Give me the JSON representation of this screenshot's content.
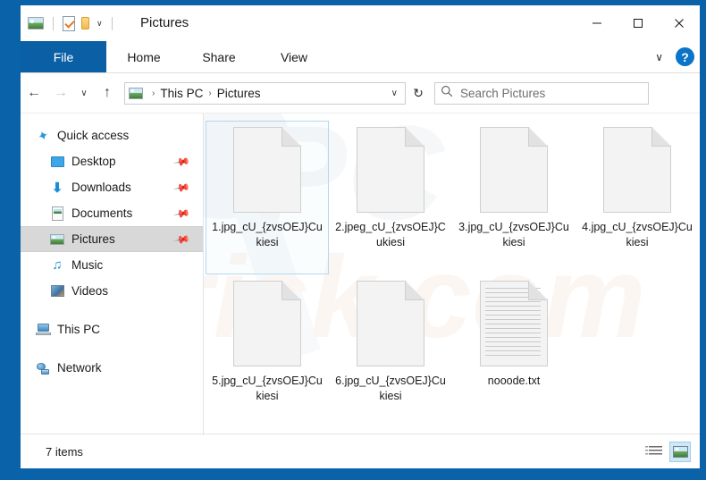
{
  "window": {
    "title": "Pictures",
    "quick_access_icons": [
      "picture-icon",
      "properties-icon",
      "new-folder-icon",
      "customize-chevron-icon"
    ],
    "controls": {
      "minimize": "minimize-icon",
      "maximize": "maximize-icon",
      "close": "close-icon"
    },
    "accent_color": "#0a62a9",
    "file_tab_color": "#0b5fa5"
  },
  "ribbon": {
    "tabs": [
      {
        "label": "File",
        "active": true
      },
      {
        "label": "Home",
        "active": false
      },
      {
        "label": "Share",
        "active": false
      },
      {
        "label": "View",
        "active": false
      }
    ],
    "expand_label": "∨",
    "help_label": "?"
  },
  "navigation": {
    "back_label": "←",
    "forward_label": "→",
    "recent_label": "∨",
    "up_label": "↑",
    "refresh_label": "↻",
    "breadcrumb": [
      "This PC",
      "Pictures"
    ],
    "breadcrumb_separator": "›",
    "address_chevron": "∨"
  },
  "search": {
    "placeholder": "Search Pictures",
    "icon": "search-icon"
  },
  "sidebar": {
    "items": [
      {
        "label": "Quick access",
        "icon": "star-icon",
        "child": false,
        "pinned": false,
        "selected": false
      },
      {
        "label": "Desktop",
        "icon": "desktop-icon",
        "child": true,
        "pinned": true,
        "selected": false
      },
      {
        "label": "Downloads",
        "icon": "downloads-icon",
        "child": true,
        "pinned": true,
        "selected": false
      },
      {
        "label": "Documents",
        "icon": "documents-icon",
        "child": true,
        "pinned": true,
        "selected": false
      },
      {
        "label": "Pictures",
        "icon": "pictures-icon",
        "child": true,
        "pinned": true,
        "selected": true
      },
      {
        "label": "Music",
        "icon": "music-icon",
        "child": true,
        "pinned": false,
        "selected": false
      },
      {
        "label": "Videos",
        "icon": "videos-icon",
        "child": true,
        "pinned": false,
        "selected": false
      },
      {
        "label": "This PC",
        "icon": "this-pc-icon",
        "child": false,
        "pinned": false,
        "selected": false
      },
      {
        "label": "Network",
        "icon": "network-icon",
        "child": false,
        "pinned": false,
        "selected": false
      }
    ]
  },
  "files": [
    {
      "name": "1.jpg_cU_{zvsOEJ}Cukiesi",
      "type": "blank-file",
      "focused": true
    },
    {
      "name": "2.jpeg_cU_{zvsOEJ}Cukiesi",
      "type": "blank-file",
      "focused": false
    },
    {
      "name": "3.jpg_cU_{zvsOEJ}Cukiesi",
      "type": "blank-file",
      "focused": false
    },
    {
      "name": "4.jpg_cU_{zvsOEJ}Cukiesi",
      "type": "blank-file",
      "focused": false
    },
    {
      "name": "5.jpg_cU_{zvsOEJ}Cukiesi",
      "type": "blank-file",
      "focused": false
    },
    {
      "name": "6.jpg_cU_{zvsOEJ}Cukiesi",
      "type": "blank-file",
      "focused": false
    },
    {
      "name": "nooode.txt",
      "type": "text-file",
      "focused": false
    }
  ],
  "status": {
    "item_count": "7 items",
    "views": [
      {
        "name": "details-view",
        "active": false
      },
      {
        "name": "large-icons-view",
        "active": true
      }
    ]
  },
  "watermark": {
    "text": "pcrisk.com"
  }
}
